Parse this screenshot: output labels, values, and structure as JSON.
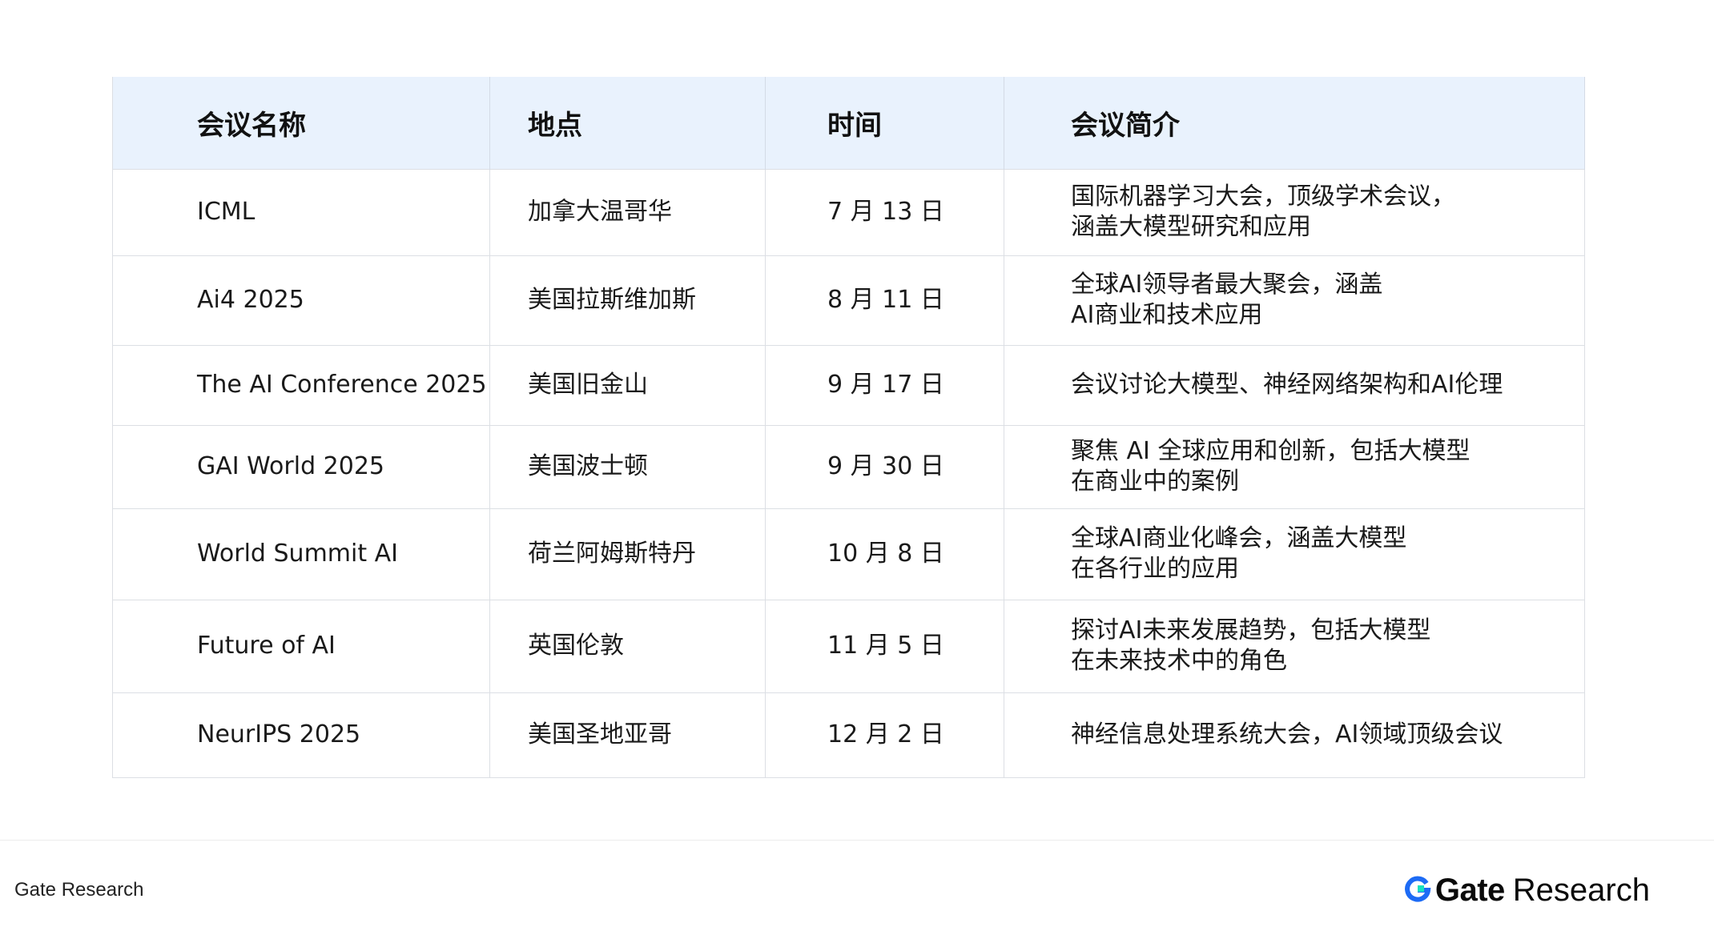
{
  "table": {
    "headers": [
      "会议名称",
      "地点",
      "时间",
      "会议简介"
    ],
    "rows": [
      {
        "name": "ICML",
        "location": "加拿大温哥华",
        "date": "7 月 13 日",
        "desc": "国际机器学习大会，顶级学术会议，\n涵盖大模型研究和应用"
      },
      {
        "name": "Ai4 2025",
        "location": "美国拉斯维加斯",
        "date": "8 月 11 日",
        "desc": "全球AI领导者最大聚会，涵盖\nAI商业和技术应用"
      },
      {
        "name": "The AI Conference 2025",
        "location": "美国旧金山",
        "date": "9 月 17 日",
        "desc": "会议讨论大模型、神经网络架构和AI伦理"
      },
      {
        "name": "GAI World 2025",
        "location": "美国波士顿",
        "date": "9 月 30 日",
        "desc": "聚焦 AI 全球应用和创新，包括大模型\n在商业中的案例"
      },
      {
        "name": "World Summit AI",
        "location": "荷兰阿姆斯特丹",
        "date": "10 月 8 日",
        "desc": "全球AI商业化峰会，涵盖大模型\n在各行业的应用"
      },
      {
        "name": "Future of AI",
        "location": "英国伦敦",
        "date": "11 月 5 日",
        "desc": "探讨AI未来发展趋势，包括大模型\n在未来技术中的角色"
      },
      {
        "name": "NeurIPS 2025",
        "location": "美国圣地亚哥",
        "date": "12 月 2 日",
        "desc": "神经信息处理系统大会，AI领域顶级会议"
      }
    ]
  },
  "footer": {
    "source": "Gate Research",
    "brand_gate": "Gate",
    "brand_research": "Research",
    "logo_icon": "gate-logo-icon"
  },
  "colors": {
    "header_bg": "#e9f2fd",
    "border": "#dcdfe4",
    "brand_blue": "#1d6bf5",
    "brand_teal": "#17e1c0"
  }
}
